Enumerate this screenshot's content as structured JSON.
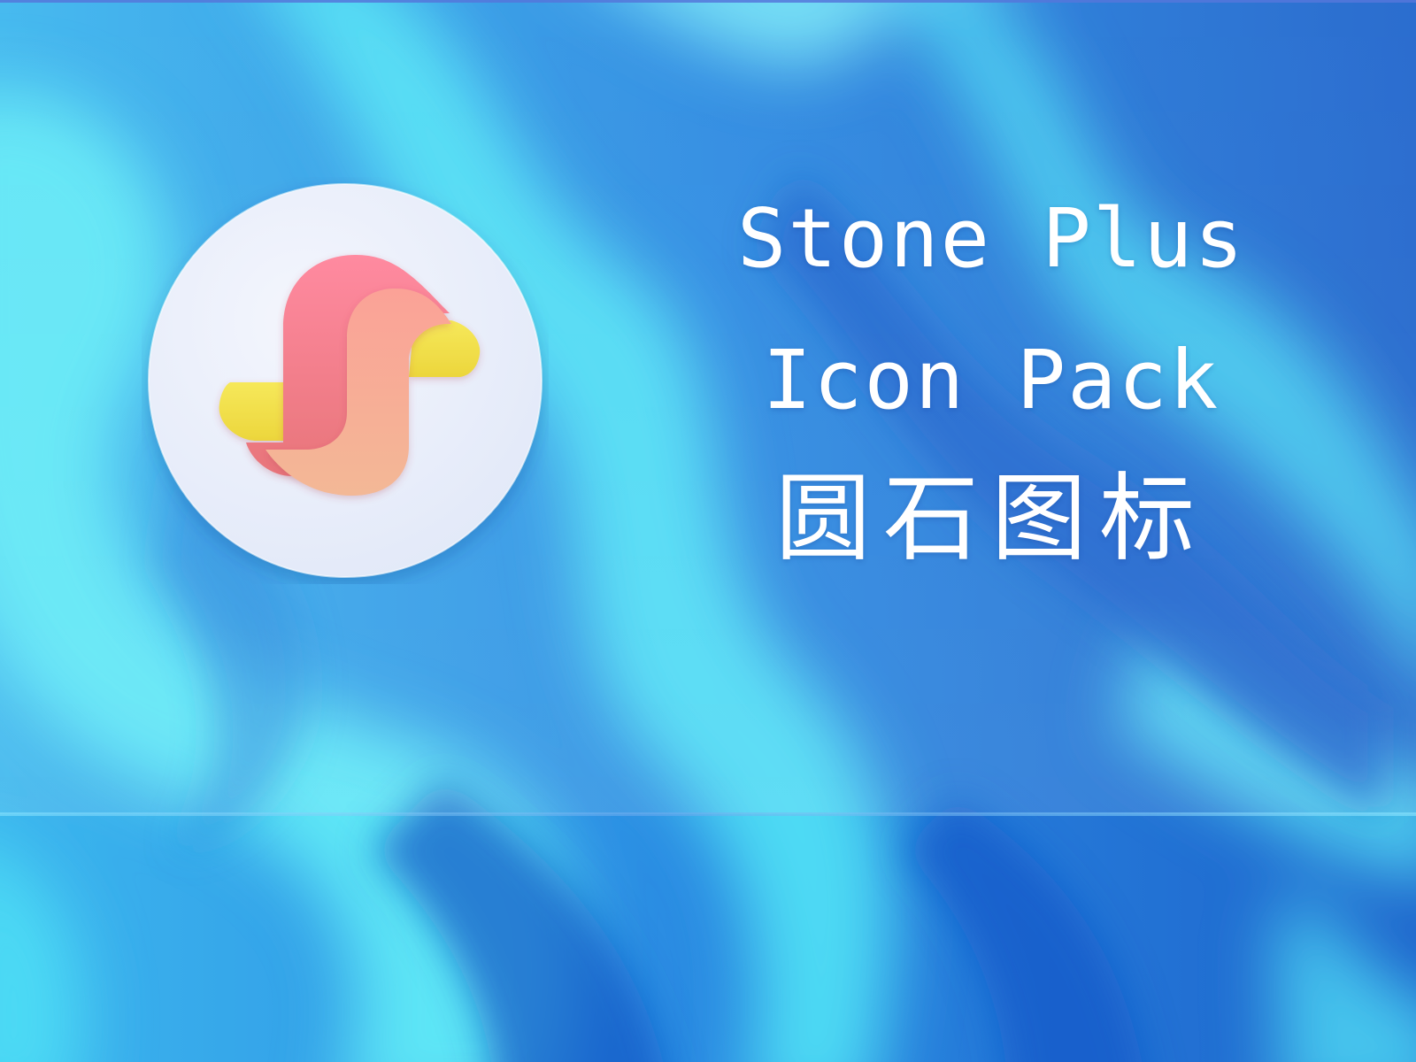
{
  "banner": {
    "title_line_1": "Stone Plus",
    "title_line_2": "Icon Pack",
    "title_cn": "圆石图标"
  },
  "icon": {
    "name": "stone-plus-app-icon",
    "colors": {
      "disc": "#eaf0fb",
      "ribbon_pink": "#f57e8c",
      "ribbon_peach": "#f8ad98",
      "accent_yellow": "#f3e04a"
    }
  },
  "colors": {
    "bg_deep_blue": "#1e6fd6",
    "bg_cyan": "#5de8f8",
    "text": "#ffffff"
  }
}
